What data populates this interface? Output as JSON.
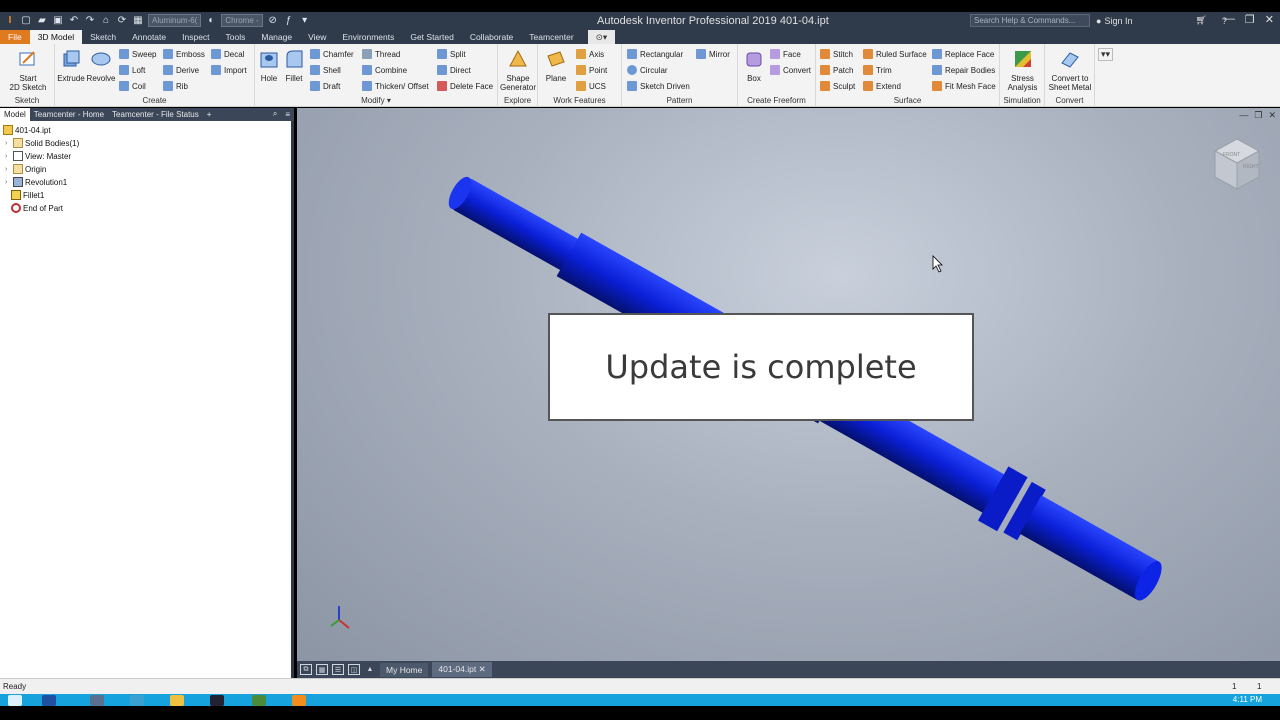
{
  "window": {
    "title": "Autodesk Inventor Professional 2019   401-04.ipt",
    "material_combo": "Aluminum-6(",
    "appearance_combo": "Chrome -",
    "search_placeholder": "Search Help & Commands...",
    "sign_in": "Sign In"
  },
  "ribbon_tabs": [
    {
      "label": "File"
    },
    {
      "label": "3D Model"
    },
    {
      "label": "Sketch"
    },
    {
      "label": "Annotate"
    },
    {
      "label": "Inspect"
    },
    {
      "label": "Tools"
    },
    {
      "label": "Manage"
    },
    {
      "label": "View"
    },
    {
      "label": "Environments"
    },
    {
      "label": "Get Started"
    },
    {
      "label": "Collaborate"
    },
    {
      "label": "Teamcenter"
    }
  ],
  "ribbon": {
    "sketch": {
      "label": "Sketch",
      "start": "Start",
      "start2": "2D Sketch"
    },
    "create": {
      "label": "Create",
      "extrude": "Extrude",
      "revolve": "Revolve",
      "sweep": "Sweep",
      "loft": "Loft",
      "coil": "Coil",
      "emboss": "Emboss",
      "derive": "Derive",
      "rib": "Rib",
      "decal": "Decal",
      "import": "Import"
    },
    "modify": {
      "label": "Modify",
      "hole": "Hole",
      "fillet": "Fillet",
      "chamfer": "Chamfer",
      "shell": "Shell",
      "draft": "Draft",
      "thread": "Thread",
      "combine": "Combine",
      "thicken": "Thicken/ Offset",
      "split": "Split",
      "direct": "Direct",
      "delete_face": "Delete Face"
    },
    "explore": {
      "label": "Explore",
      "shape": "Shape",
      "generator": "Generator"
    },
    "work": {
      "label": "Work Features",
      "plane": "Plane",
      "axis": "Axis",
      "point": "Point",
      "ucs": "UCS"
    },
    "pattern": {
      "label": "Pattern",
      "rectangular": "Rectangular",
      "circular": "Circular",
      "sketch_driven": "Sketch Driven",
      "mirror": "Mirror"
    },
    "freeform": {
      "label": "Create Freeform",
      "box": "Box",
      "face": "Face",
      "convert": "Convert"
    },
    "surface": {
      "label": "Surface",
      "stitch": "Stitch",
      "patch": "Patch",
      "sculpt": "Sculpt",
      "ruled": "Ruled Surface",
      "trim": "Trim",
      "extend": "Extend",
      "replace": "Replace Face",
      "repair": "Repair Bodies",
      "fitmesh": "Fit Mesh Face"
    },
    "simulation": {
      "label": "Simulation",
      "stress": "Stress",
      "analysis": "Analysis"
    },
    "convert": {
      "label": "Convert",
      "convert_to": "Convert to",
      "sheet_metal": "Sheet Metal"
    }
  },
  "browser": {
    "tabs": [
      "Model",
      "Teamcenter - Home",
      "Teamcenter - File Status"
    ],
    "items": [
      {
        "label": "401-04.ipt"
      },
      {
        "label": "Solid Bodies(1)"
      },
      {
        "label": "View: Master"
      },
      {
        "label": "Origin"
      },
      {
        "label": "Revolution1"
      },
      {
        "label": "Fillet1"
      },
      {
        "label": "End of Part"
      }
    ]
  },
  "viewport": {
    "message": "Update is complete",
    "viewcube_front": "FRONT",
    "viewcube_right": "RIGHT",
    "part_color": "#0a1fd6"
  },
  "doc_tabs": [
    {
      "label": "My Home"
    },
    {
      "label": "401-04.ipt"
    }
  ],
  "status": {
    "text": "Ready",
    "n1": "1",
    "n2": "1"
  },
  "taskbar": {
    "time": "4:11 PM"
  }
}
